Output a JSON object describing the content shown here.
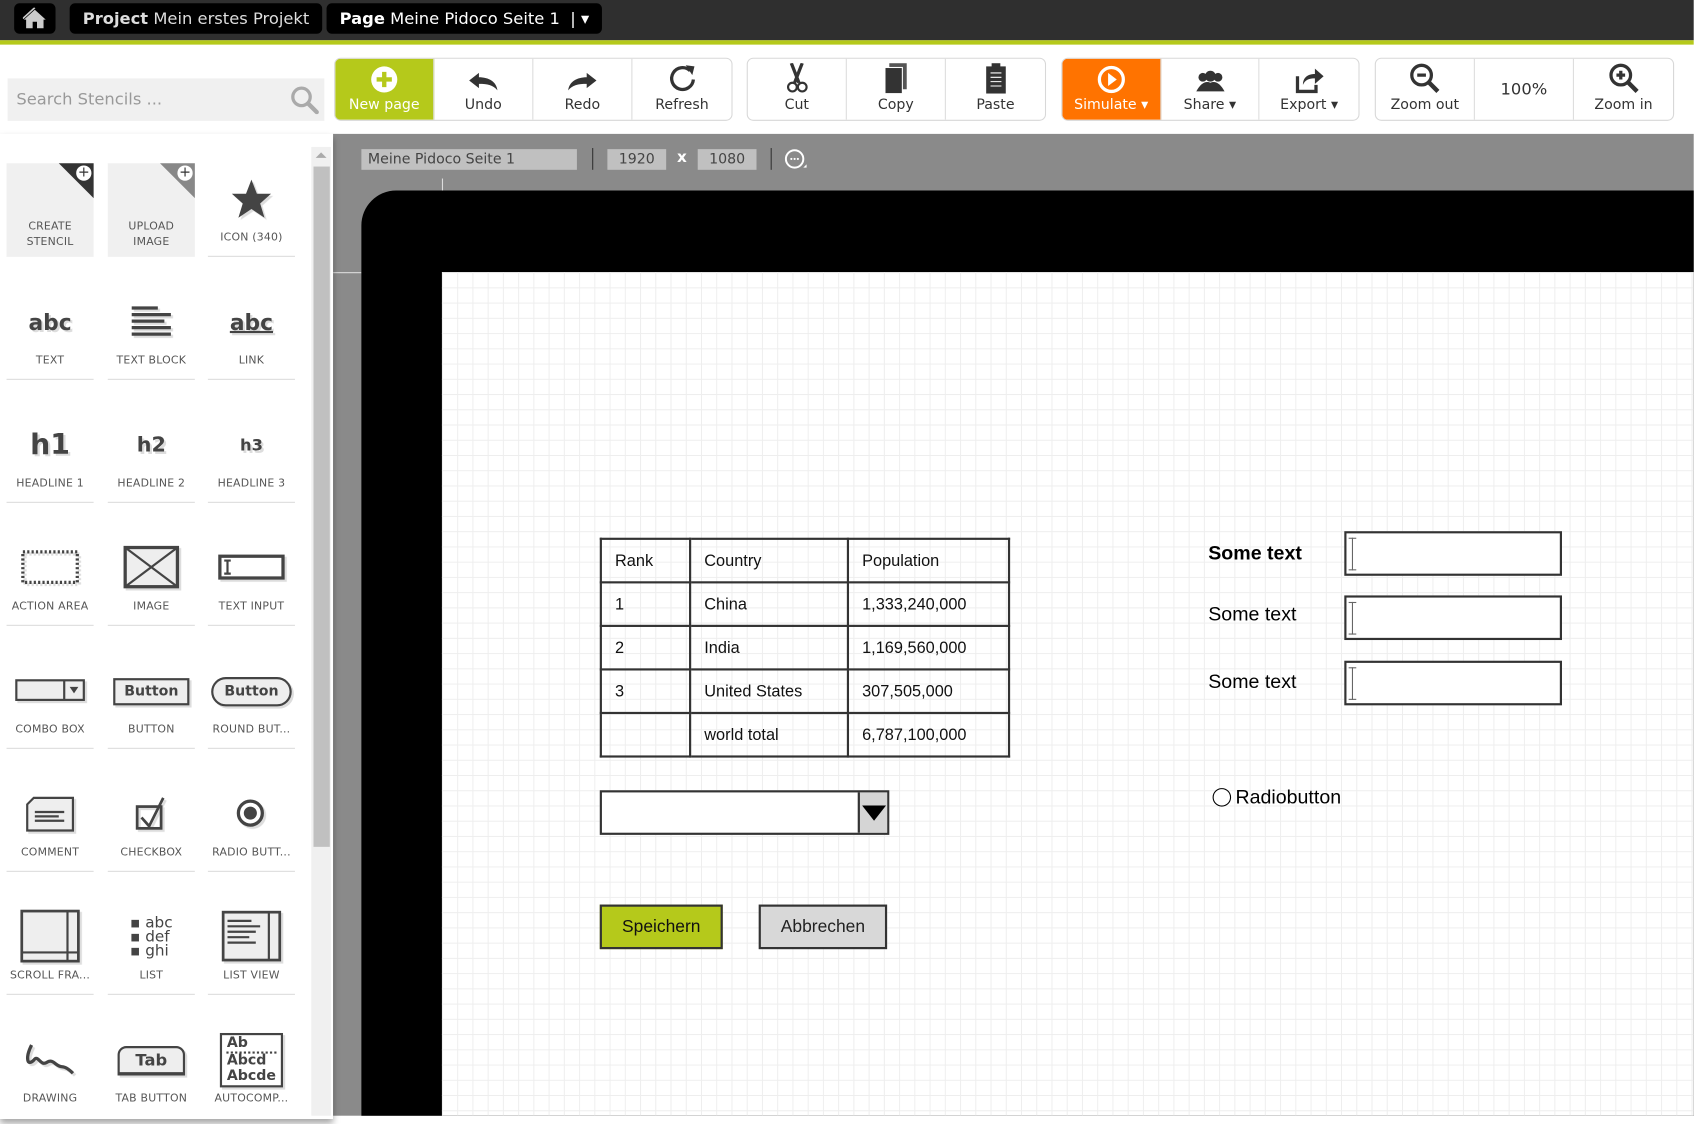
{
  "topbar": {
    "project_label": "Project",
    "project_name": "Mein erstes Projekt",
    "page_label": "Page",
    "page_name": "Meine Pidoco Seite 1",
    "page_menu": "|  ▾"
  },
  "search": {
    "placeholder": "Search Stencils ..."
  },
  "toolbar": {
    "new_page": "New page",
    "undo": "Undo",
    "redo": "Redo",
    "refresh": "Refresh",
    "cut": "Cut",
    "copy": "Copy",
    "paste": "Paste",
    "simulate": "Simulate ▾",
    "share": "Share ▾",
    "export": "Export ▾",
    "zoom_out": "Zoom out",
    "zoom_level": "100%",
    "zoom_in": "Zoom in"
  },
  "colors": {
    "brand_green": "#b5c91b",
    "simulate_orange": "#ff7300",
    "topbar": "#2f2f2f"
  },
  "page_info": {
    "name": "Meine Pidoco Seite 1",
    "width": "1920",
    "x": "x",
    "height": "1080"
  },
  "stencils": [
    {
      "label": "CREATE STENCIL",
      "icon": "create-stencil-icon"
    },
    {
      "label": "UPLOAD IMAGE",
      "icon": "upload-image-icon"
    },
    {
      "label": "ICON (340)",
      "icon": "star-icon"
    },
    {
      "label": "TEXT",
      "icon": "text-icon"
    },
    {
      "label": "TEXT BLOCK",
      "icon": "text-block-icon"
    },
    {
      "label": "LINK",
      "icon": "link-icon"
    },
    {
      "label": "HEADLINE 1",
      "icon": "h1-icon"
    },
    {
      "label": "HEADLINE 2",
      "icon": "h2-icon"
    },
    {
      "label": "HEADLINE 3",
      "icon": "h3-icon"
    },
    {
      "label": "ACTION AREA",
      "icon": "action-area-icon"
    },
    {
      "label": "IMAGE",
      "icon": "image-icon"
    },
    {
      "label": "TEXT INPUT",
      "icon": "text-input-icon"
    },
    {
      "label": "COMBO BOX",
      "icon": "combo-box-icon"
    },
    {
      "label": "BUTTON",
      "icon": "button-icon"
    },
    {
      "label": "ROUND BUT...",
      "icon": "round-button-icon"
    },
    {
      "label": "COMMENT",
      "icon": "comment-icon"
    },
    {
      "label": "CHECKBOX",
      "icon": "checkbox-icon"
    },
    {
      "label": "RADIO BUTT...",
      "icon": "radio-button-icon"
    },
    {
      "label": "SCROLL FRA...",
      "icon": "scroll-frame-icon"
    },
    {
      "label": "LIST",
      "icon": "list-icon"
    },
    {
      "label": "LIST VIEW",
      "icon": "list-view-icon"
    },
    {
      "label": "DRAWING",
      "icon": "drawing-icon"
    },
    {
      "label": "TAB BUTTON",
      "icon": "tab-button-icon"
    },
    {
      "label": "AUTOCOMP...",
      "icon": "autocomplete-icon"
    }
  ],
  "stencil_icon_text": {
    "text": "abc",
    "link": "abc",
    "h1": "h1",
    "h2": "h2",
    "h3": "h3",
    "button": "Button",
    "round_button": "Button",
    "list": [
      "abc",
      "def",
      "ghi"
    ],
    "tab": "Tab",
    "autocomplete": [
      "Ab",
      "Abcd",
      "Abcde"
    ]
  },
  "canvas": {
    "table": {
      "headers": [
        "Rank",
        "Country",
        "Population"
      ],
      "rows": [
        [
          "1",
          "China",
          "1,333,240,000"
        ],
        [
          "2",
          "India",
          "1,169,560,000"
        ],
        [
          "3",
          "United States",
          "307,505,000"
        ],
        [
          "",
          "world total",
          "6,787,100,000"
        ]
      ]
    },
    "form_labels": [
      "Some text",
      "Some text",
      "Some text"
    ],
    "radio_label": "Radiobutton",
    "radio_checked": false,
    "save_button": "Speichern",
    "cancel_button": "Abbrechen"
  }
}
